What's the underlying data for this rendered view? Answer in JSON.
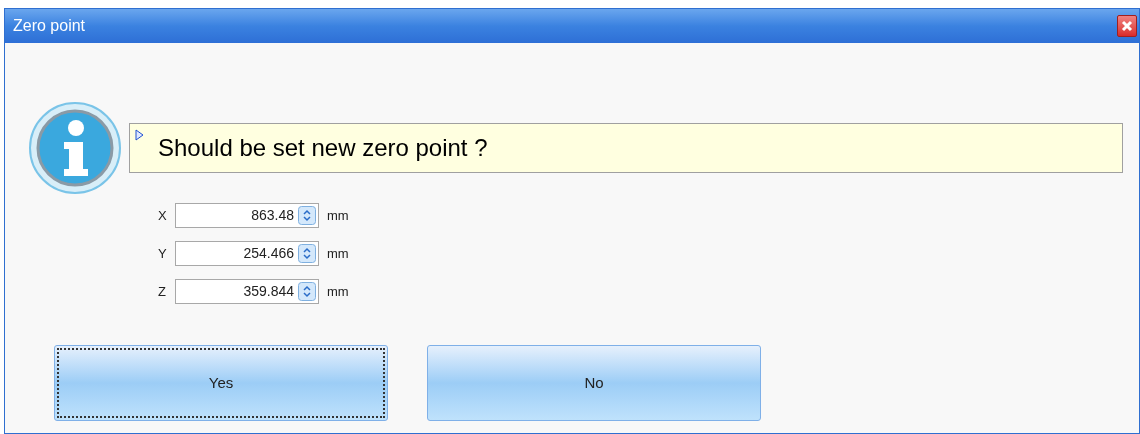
{
  "window": {
    "title": "Zero point"
  },
  "message": "Should be set new zero point ?",
  "fields": [
    {
      "label": "X",
      "value": "863.48",
      "unit": "mm"
    },
    {
      "label": "Y",
      "value": "254.466",
      "unit": "mm"
    },
    {
      "label": "Z",
      "value": "359.844",
      "unit": "mm"
    }
  ],
  "buttons": [
    {
      "label": "Yes",
      "focused": true
    },
    {
      "label": "No",
      "focused": false
    }
  ]
}
